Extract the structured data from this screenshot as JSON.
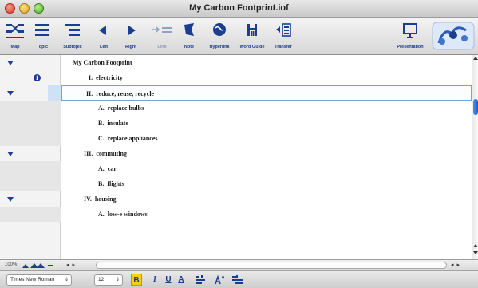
{
  "window": {
    "title": "My Carbon Footprint.iof"
  },
  "toolbar": {
    "items": [
      {
        "label": "Map",
        "icon": "map-icon"
      },
      {
        "label": "Topic",
        "icon": "topic-icon"
      },
      {
        "label": "Subtopic",
        "icon": "subtopic-icon"
      },
      {
        "label": "Left",
        "icon": "arrow-left-icon"
      },
      {
        "label": "Right",
        "icon": "arrow-right-icon"
      },
      {
        "label": "Link",
        "icon": "link-icon",
        "disabled": true
      },
      {
        "label": "Note",
        "icon": "note-icon"
      },
      {
        "label": "Hyperlink",
        "icon": "hyperlink-icon"
      },
      {
        "label": "Word Guide",
        "icon": "word-guide-icon"
      },
      {
        "label": "Transfer",
        "icon": "transfer-icon"
      },
      {
        "label": "Presentation",
        "icon": "presentation-icon"
      }
    ]
  },
  "outline": {
    "rows": [
      {
        "num": "",
        "text": "My Carbon Footprint",
        "level": 0,
        "collapse_arrow": true
      },
      {
        "num": "I.",
        "text": "electricity",
        "level": 1,
        "note_icon": true
      },
      {
        "num": "II.",
        "text": "reduce, reuse, recycle",
        "level": 1,
        "collapse_arrow": true,
        "selected": true
      },
      {
        "num": "A.",
        "text": "replace bulbs",
        "level": 2
      },
      {
        "num": "B.",
        "text": "insulate",
        "level": 2
      },
      {
        "num": "C.",
        "text": "replace appliances",
        "level": 2
      },
      {
        "num": "III.",
        "text": "commuting",
        "level": 1,
        "collapse_arrow": true
      },
      {
        "num": "A.",
        "text": "car",
        "level": 2
      },
      {
        "num": "B.",
        "text": "flights",
        "level": 2
      },
      {
        "num": "IV.",
        "text": "housing",
        "level": 1,
        "collapse_arrow": true
      },
      {
        "num": "A.",
        "text": "low-e windows",
        "level": 2
      }
    ]
  },
  "status": {
    "zoom": "100%",
    "hscroll_left": "◂ ▸",
    "hscroll_right": "◂ ▸"
  },
  "format": {
    "font_name": "Times New Roman",
    "font_size": "12",
    "bold": "B",
    "italic": "I",
    "underline": "U",
    "color": "A"
  },
  "colors": {
    "accent": "#1c3e8e",
    "selection": "#cfe0f7",
    "bold_active": "#f4d400"
  }
}
